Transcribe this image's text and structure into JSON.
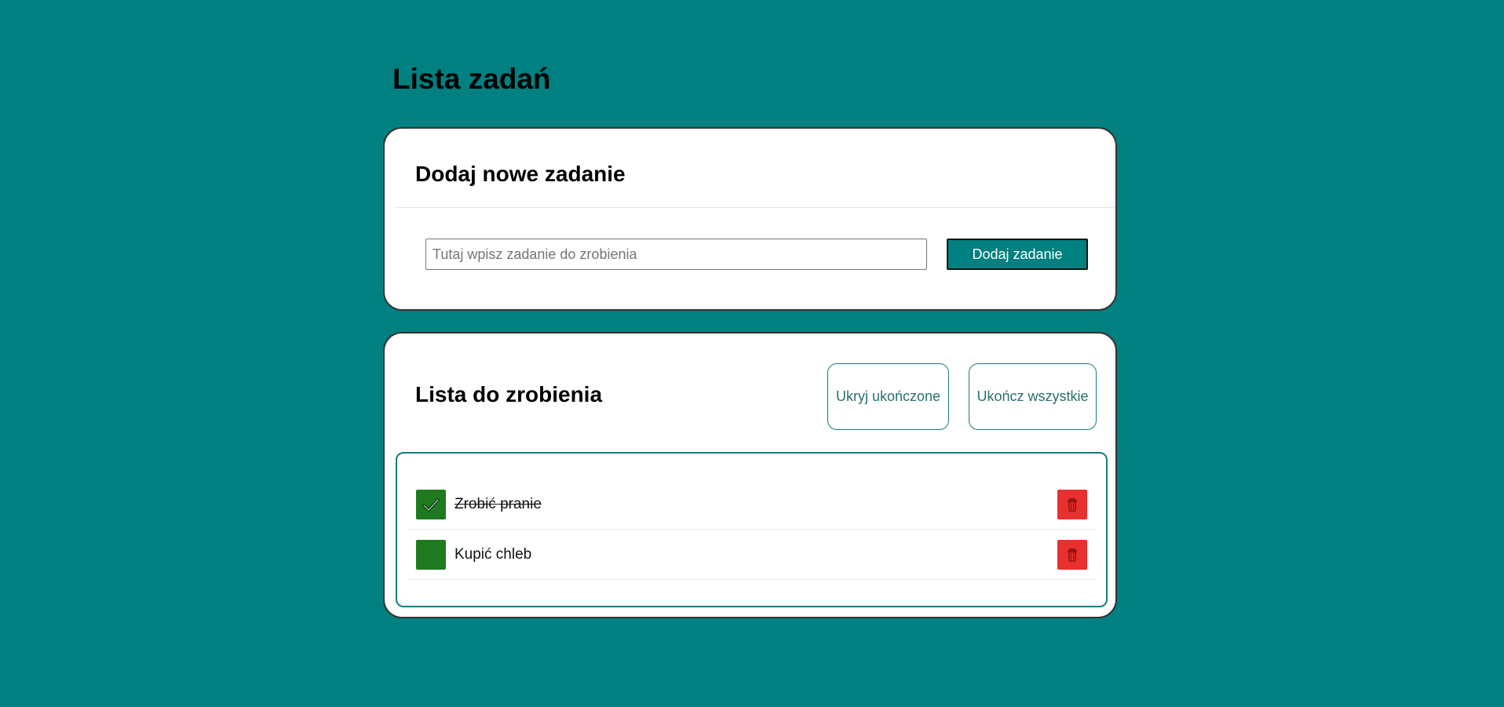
{
  "page": {
    "title": "Lista zadań"
  },
  "add_task": {
    "heading": "Dodaj nowe zadanie",
    "input_value": "",
    "input_placeholder": "Tutaj wpisz zadanie do zrobienia",
    "button_label": "Dodaj zadanie"
  },
  "todo": {
    "heading": "Lista do zrobienia",
    "hide_completed_label": "Ukryj ukończone",
    "complete_all_label": "Ukończ wszystkie",
    "items": [
      {
        "text": "Zrobić pranie",
        "done": true
      },
      {
        "text": "Kupić chleb",
        "done": false
      }
    ]
  },
  "icons": {
    "check": "check-icon",
    "delete": "trash-icon"
  },
  "colors": {
    "background": "#008080",
    "accent": "#008080",
    "check_box": "#1f7a1f",
    "delete": "#e8302f"
  }
}
